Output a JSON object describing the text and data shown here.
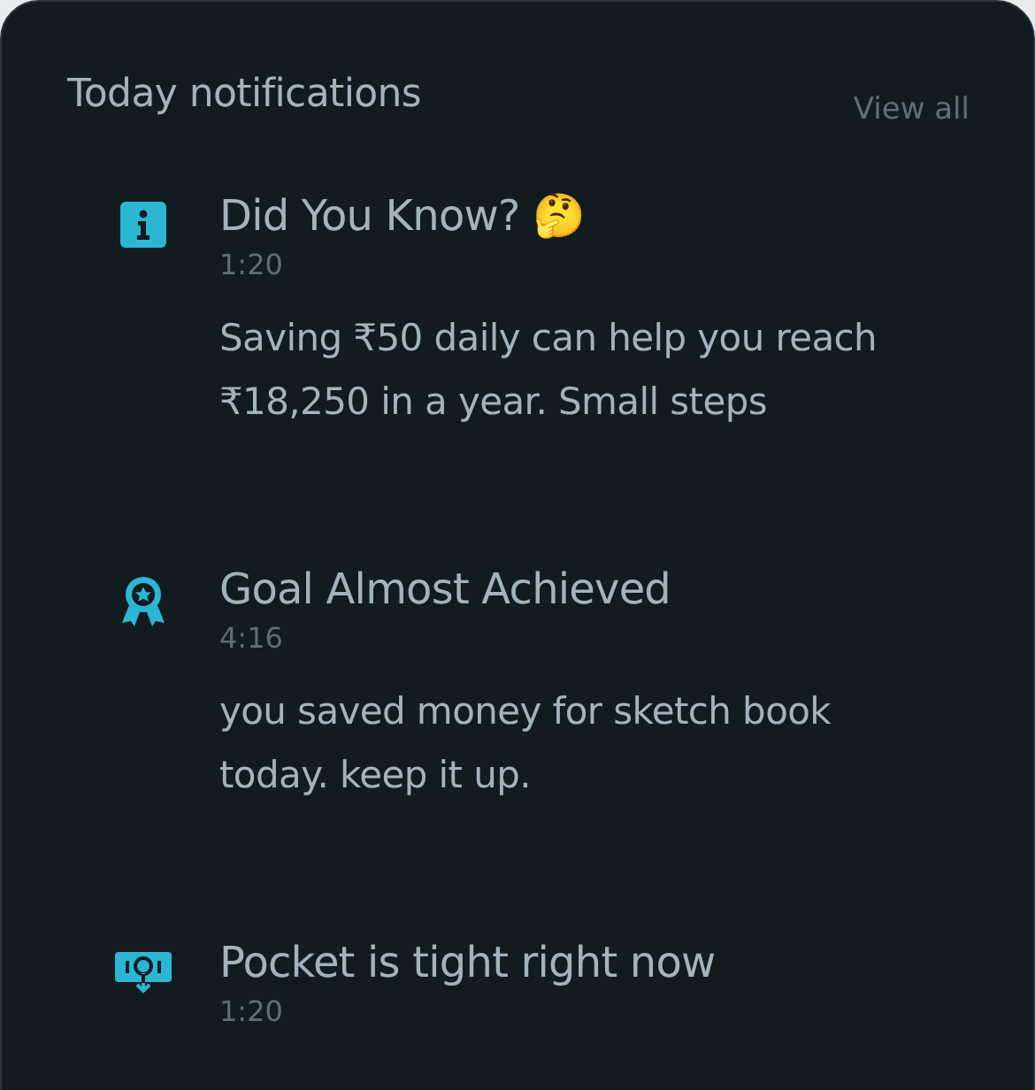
{
  "header": {
    "title": "Today notifications",
    "link": "View all"
  },
  "notifications": [
    {
      "kind": "info",
      "title": "Did You Know? 🤔",
      "time": "1:20",
      "body": "Saving ₹50 daily can help you reach ₹18,250 in a year. Small steps"
    },
    {
      "kind": "award",
      "title": "Goal Almost Achieved",
      "time": "4:16",
      "body": "you saved money for sketch book today. keep it up."
    },
    {
      "kind": "cash",
      "title": "Pocket is tight right now",
      "time": "1:20"
    }
  ]
}
